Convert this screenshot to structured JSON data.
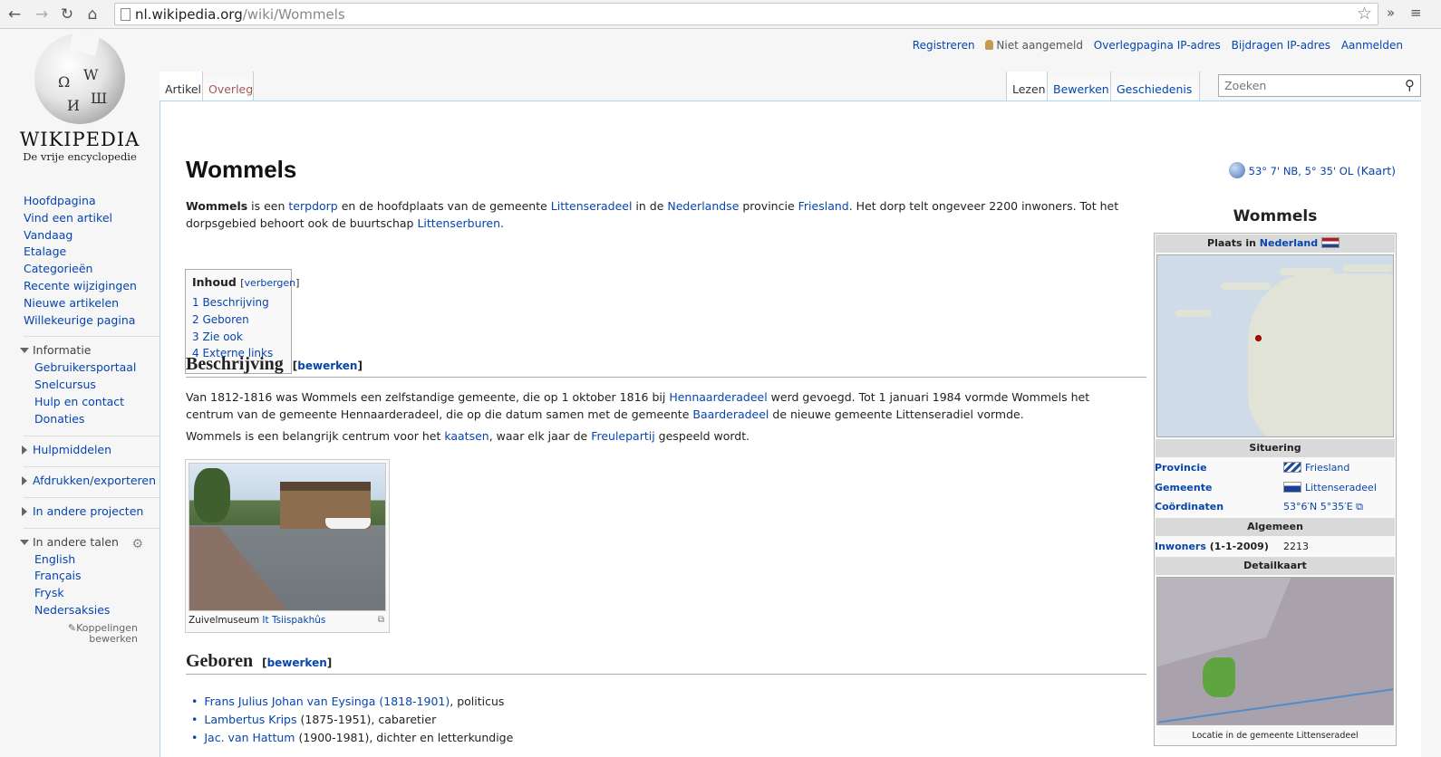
{
  "browser": {
    "url_host": "nl.wikipedia.org",
    "url_path": "/wiki/Wommels"
  },
  "logo": {
    "wordmark": "WIKIPEDIA",
    "tagline": "De vrije encyclopedie"
  },
  "personal": {
    "register": "Registreren",
    "not_logged_in": "Niet aangemeld",
    "talk": "Overlegpagina IP-adres",
    "contribs": "Bijdragen IP-adres",
    "login": "Aanmelden"
  },
  "tabs": {
    "article": "Artikel",
    "talk": "Overleg",
    "read": "Lezen",
    "edit": "Bewerken",
    "history": "Geschiedenis"
  },
  "search": {
    "placeholder": "Zoeken"
  },
  "sidebar": {
    "nav": [
      "Hoofdpagina",
      "Vind een artikel",
      "Vandaag",
      "Etalage",
      "Categorieën",
      "Recente wijzigingen",
      "Nieuwe artikelen",
      "Willekeurige pagina"
    ],
    "info_head": "Informatie",
    "info": [
      "Gebruikersportaal",
      "Snelcursus",
      "Hulp en contact",
      "Donaties"
    ],
    "tools_head": "Hulpmiddelen",
    "print_head": "Afdrukken/exporteren",
    "projects_head": "In andere projecten",
    "lang_head": "In andere talen",
    "langs": [
      "English",
      "Français",
      "Frysk",
      "Nedersaksies"
    ],
    "edit_links_1": "Koppelingen",
    "edit_links_2": "bewerken"
  },
  "article": {
    "title": "Wommels",
    "coords": "53° 7' NB, 5° 35' OL",
    "map_link": "(Kaart)",
    "intro": {
      "bold": "Wommels",
      "t1": " is een ",
      "l1": "terpdorp",
      "t2": " en de hoofdplaats van de gemeente ",
      "l2": "Littenseradeel",
      "t3": " in de ",
      "l3": "Nederlandse",
      "t4": " provincie ",
      "l4": "Friesland",
      "t5": ". Het dorp telt ongeveer 2200 inwoners. Tot het dorpsgebied behoort ook de buurtschap ",
      "l5": "Littenserburen",
      "t6": "."
    },
    "toc": {
      "title": "Inhoud",
      "hide": "verbergen",
      "items": [
        "1 Beschrijving",
        "2 Geboren",
        "3 Zie ook",
        "4 Externe links"
      ]
    },
    "section1": {
      "title": "Beschrijving",
      "edit": "bewerken"
    },
    "p2": {
      "t1": "Van 1812-1816 was Wommels een zelfstandige gemeente, die op 1 oktober 1816 bij ",
      "l1": "Hennaarderadeel",
      "t2": " werd gevoegd. Tot 1 januari 1984 vormde Wommels het centrum van de gemeente Hennaarderadeel, die op die datum samen met de gemeente ",
      "l2": "Baarderadeel",
      "t3": " de nieuwe gemeente Littenseradiel vormde."
    },
    "p3": {
      "t1": "Wommels is een belangrijk centrum voor het ",
      "l1": "kaatsen",
      "t2": ", waar elk jaar de ",
      "l2": "Freulepartij",
      "t3": " gespeeld wordt."
    },
    "thumb": {
      "caption_text": "Zuivelmuseum ",
      "caption_link": "It Tsiispakhûs"
    },
    "section2": {
      "title": "Geboren",
      "edit": "bewerken"
    },
    "born": [
      {
        "link": "Frans Julius Johan van Eysinga (1818-1901)",
        "text": ", politicus"
      },
      {
        "link": "Lambertus Krips",
        "text": " (1875-1951), cabaretier"
      },
      {
        "link": "Jac. van Hattum",
        "text": " (1900-1981), dichter en letterkundige"
      }
    ]
  },
  "infobox": {
    "title": "Wommels",
    "place_in": "Plaats in ",
    "country": "Nederland",
    "situering": "Situering",
    "province_k": "Provincie",
    "province_v": "Friesland",
    "municipality_k": "Gemeente",
    "municipality_v": "Littenseradeel",
    "coords_k": "Coördinaten",
    "coords_v": "53°6′N  5°35′E",
    "general": "Algemeen",
    "inhabitants_k": "Inwoners",
    "inhabitants_date": " (1-1-2009)",
    "inhabitants_v": "2213",
    "detail": "Detailkaart",
    "detail_caption": "Locatie in de gemeente Littenseradeel"
  },
  "colors": {
    "link": "#0645ad",
    "new_link": "#a55858",
    "content_border": "#a7d7f9"
  }
}
